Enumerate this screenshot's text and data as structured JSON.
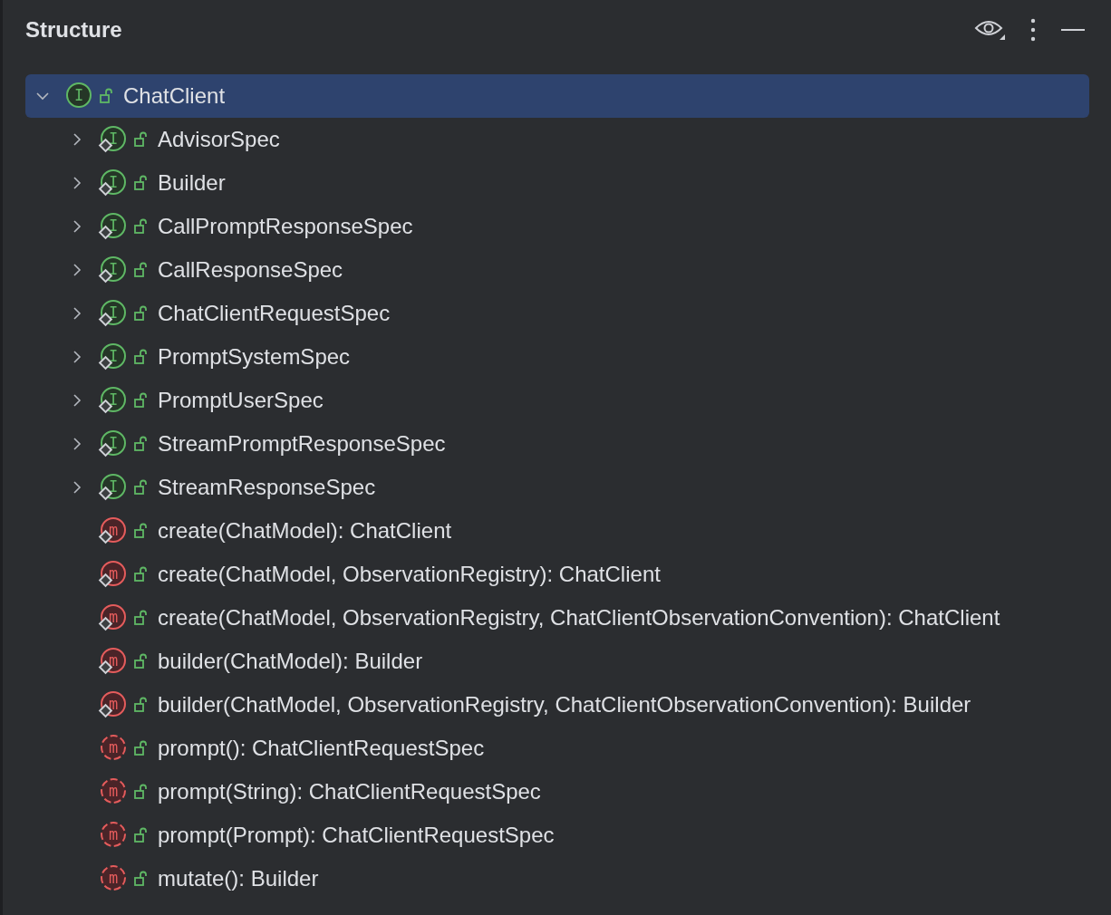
{
  "panel": {
    "title": "Structure"
  },
  "tree": [
    {
      "label": "ChatClient",
      "kind": "interface",
      "badge": "I",
      "expanded": true,
      "selected": true,
      "children": [
        {
          "label": "AdvisorSpec",
          "kind": "static-interface",
          "badge": "I",
          "expanded": false,
          "selected": false
        },
        {
          "label": "Builder",
          "kind": "static-interface",
          "badge": "I",
          "expanded": false,
          "selected": false
        },
        {
          "label": "CallPromptResponseSpec",
          "kind": "static-interface",
          "badge": "I",
          "expanded": false,
          "selected": false
        },
        {
          "label": "CallResponseSpec",
          "kind": "static-interface",
          "badge": "I",
          "expanded": false,
          "selected": false
        },
        {
          "label": "ChatClientRequestSpec",
          "kind": "static-interface",
          "badge": "I",
          "expanded": false,
          "selected": false
        },
        {
          "label": "PromptSystemSpec",
          "kind": "static-interface",
          "badge": "I",
          "expanded": false,
          "selected": false
        },
        {
          "label": "PromptUserSpec",
          "kind": "static-interface",
          "badge": "I",
          "expanded": false,
          "selected": false
        },
        {
          "label": "StreamPromptResponseSpec",
          "kind": "static-interface",
          "badge": "I",
          "expanded": false,
          "selected": false
        },
        {
          "label": "StreamResponseSpec",
          "kind": "static-interface",
          "badge": "I",
          "expanded": false,
          "selected": false
        },
        {
          "label": "create(ChatModel): ChatClient",
          "kind": "static-method",
          "badge": "m",
          "selected": false
        },
        {
          "label": "create(ChatModel, ObservationRegistry): ChatClient",
          "kind": "static-method",
          "badge": "m",
          "selected": false
        },
        {
          "label": "create(ChatModel, ObservationRegistry, ChatClientObservationConvention): ChatClient",
          "kind": "static-method",
          "badge": "m",
          "selected": false
        },
        {
          "label": "builder(ChatModel): Builder",
          "kind": "static-method",
          "badge": "m",
          "selected": false
        },
        {
          "label": "builder(ChatModel, ObservationRegistry, ChatClientObservationConvention): Builder",
          "kind": "static-method",
          "badge": "m",
          "selected": false
        },
        {
          "label": "prompt(): ChatClientRequestSpec",
          "kind": "abstract-method",
          "badge": "m",
          "selected": false
        },
        {
          "label": "prompt(String): ChatClientRequestSpec",
          "kind": "abstract-method",
          "badge": "m",
          "selected": false
        },
        {
          "label": "prompt(Prompt): ChatClientRequestSpec",
          "kind": "abstract-method",
          "badge": "m",
          "selected": false
        },
        {
          "label": "mutate(): Builder",
          "kind": "abstract-method",
          "badge": "m",
          "selected": false
        }
      ]
    }
  ]
}
